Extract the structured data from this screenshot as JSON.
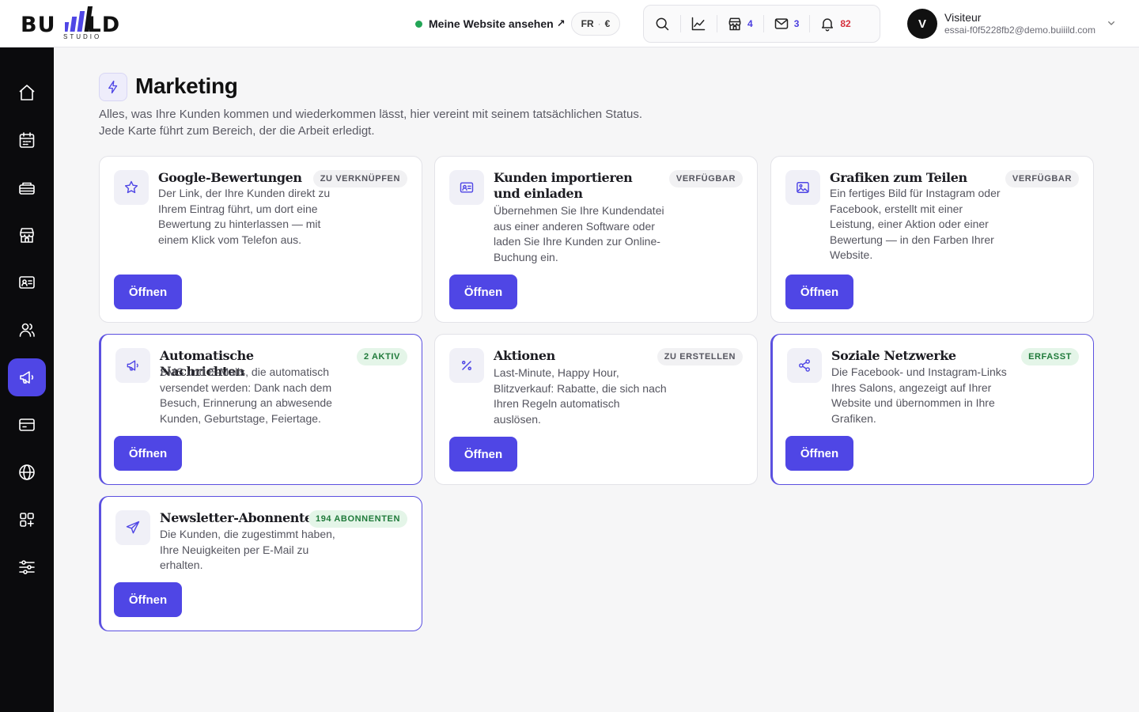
{
  "header": {
    "logo_text_left": "BU",
    "logo_text_right": "LD",
    "logo_subtitle": "STUDIO",
    "site_link_label": "Meine Website ansehen",
    "site_link_arrow": "↗",
    "lang_code": "FR",
    "lang_sep": "·",
    "currency": "€",
    "tools": {
      "search_icon": "search-icon",
      "stats_icon": "chart-line-icon",
      "shop_count": "4",
      "mail_count": "3",
      "bell_count": "82"
    },
    "user": {
      "initial": "V",
      "name": "Visiteur",
      "email": "essai-f0f5228fb2@demo.buiiild.com"
    }
  },
  "sidebar": {
    "items": [
      {
        "icon": "home-icon"
      },
      {
        "icon": "calendar-icon"
      },
      {
        "icon": "services-icon"
      },
      {
        "icon": "store-icon"
      },
      {
        "icon": "contact-card-icon"
      },
      {
        "icon": "users-icon"
      },
      {
        "icon": "megaphone-icon",
        "active": true
      },
      {
        "icon": "payment-card-icon"
      },
      {
        "icon": "globe-icon"
      },
      {
        "icon": "apps-icon"
      },
      {
        "icon": "sliders-icon"
      }
    ]
  },
  "main": {
    "title": "Marketing",
    "description_line1": "Alles, was Ihre Kunden kommen und wiederkommen lässt, hier vereint mit seinem tatsächlichen Status.",
    "description_line2": "Jede Karte führt zum Bereich, der die Arbeit erledigt.",
    "open_label": "Öffnen",
    "cards": [
      {
        "title": "Google-Bewertungen",
        "badge": "ZU VERKNÜPFEN",
        "badge_style": "gray",
        "icon": "star-icon",
        "description": "Der Link, der Ihre Kunden direkt zu Ihrem Eintrag führt, um dort eine Bewertung zu hinterlassen — mit einem Klick vom Telefon aus."
      },
      {
        "title": "Kunden importieren und einladen",
        "badge": "VERFÜGBAR",
        "badge_style": "gray",
        "icon": "id-card-icon",
        "description": "Übernehmen Sie Ihre Kundendatei aus einer anderen Software oder laden Sie Ihre Kunden zur Online-Buchung ein."
      },
      {
        "title": "Grafiken zum Teilen",
        "badge": "VERFÜGBAR",
        "badge_style": "gray",
        "icon": "image-icon",
        "description": "Ein fertiges Bild für Instagram oder Facebook, erstellt mit einer Leistung, einer Aktion oder einer Bewertung — in den Farben Ihrer Website."
      },
      {
        "title": "Automatische Nachrichten",
        "badge": "2 AKTIV",
        "badge_style": "green",
        "icon": "megaphone-icon",
        "description": "SMS und E-Mails, die automatisch versendet werden: Dank nach dem Besuch, Erinnerung an abwesende Kunden, Geburtstage, Feiertage."
      },
      {
        "title": "Aktionen",
        "badge": "ZU ERSTELLEN",
        "badge_style": "gray",
        "icon": "percent-icon",
        "description": "Last-Minute, Happy Hour, Blitzverkauf: Rabatte, die sich nach Ihren Regeln automatisch auslösen."
      },
      {
        "title": "Soziale Netzwerke",
        "badge": "ERFASST",
        "badge_style": "green",
        "icon": "share-icon",
        "description": "Die Facebook- und Instagram-Links Ihres Salons, angezeigt auf Ihrer Website und übernommen in Ihre Grafiken."
      },
      {
        "title": "Newsletter-Abonnenten",
        "badge": "194 ABONNENTEN",
        "badge_style": "green",
        "icon": "send-icon",
        "description": "Die Kunden, die zugestimmt haben, Ihre Neuigkeiten per E-Mail zu erhalten."
      }
    ]
  },
  "colors": {
    "accent": "#4f46e5",
    "sidebar_bg": "#0b0b0d",
    "status_green": "#22a556",
    "count_red": "#d6303c"
  }
}
